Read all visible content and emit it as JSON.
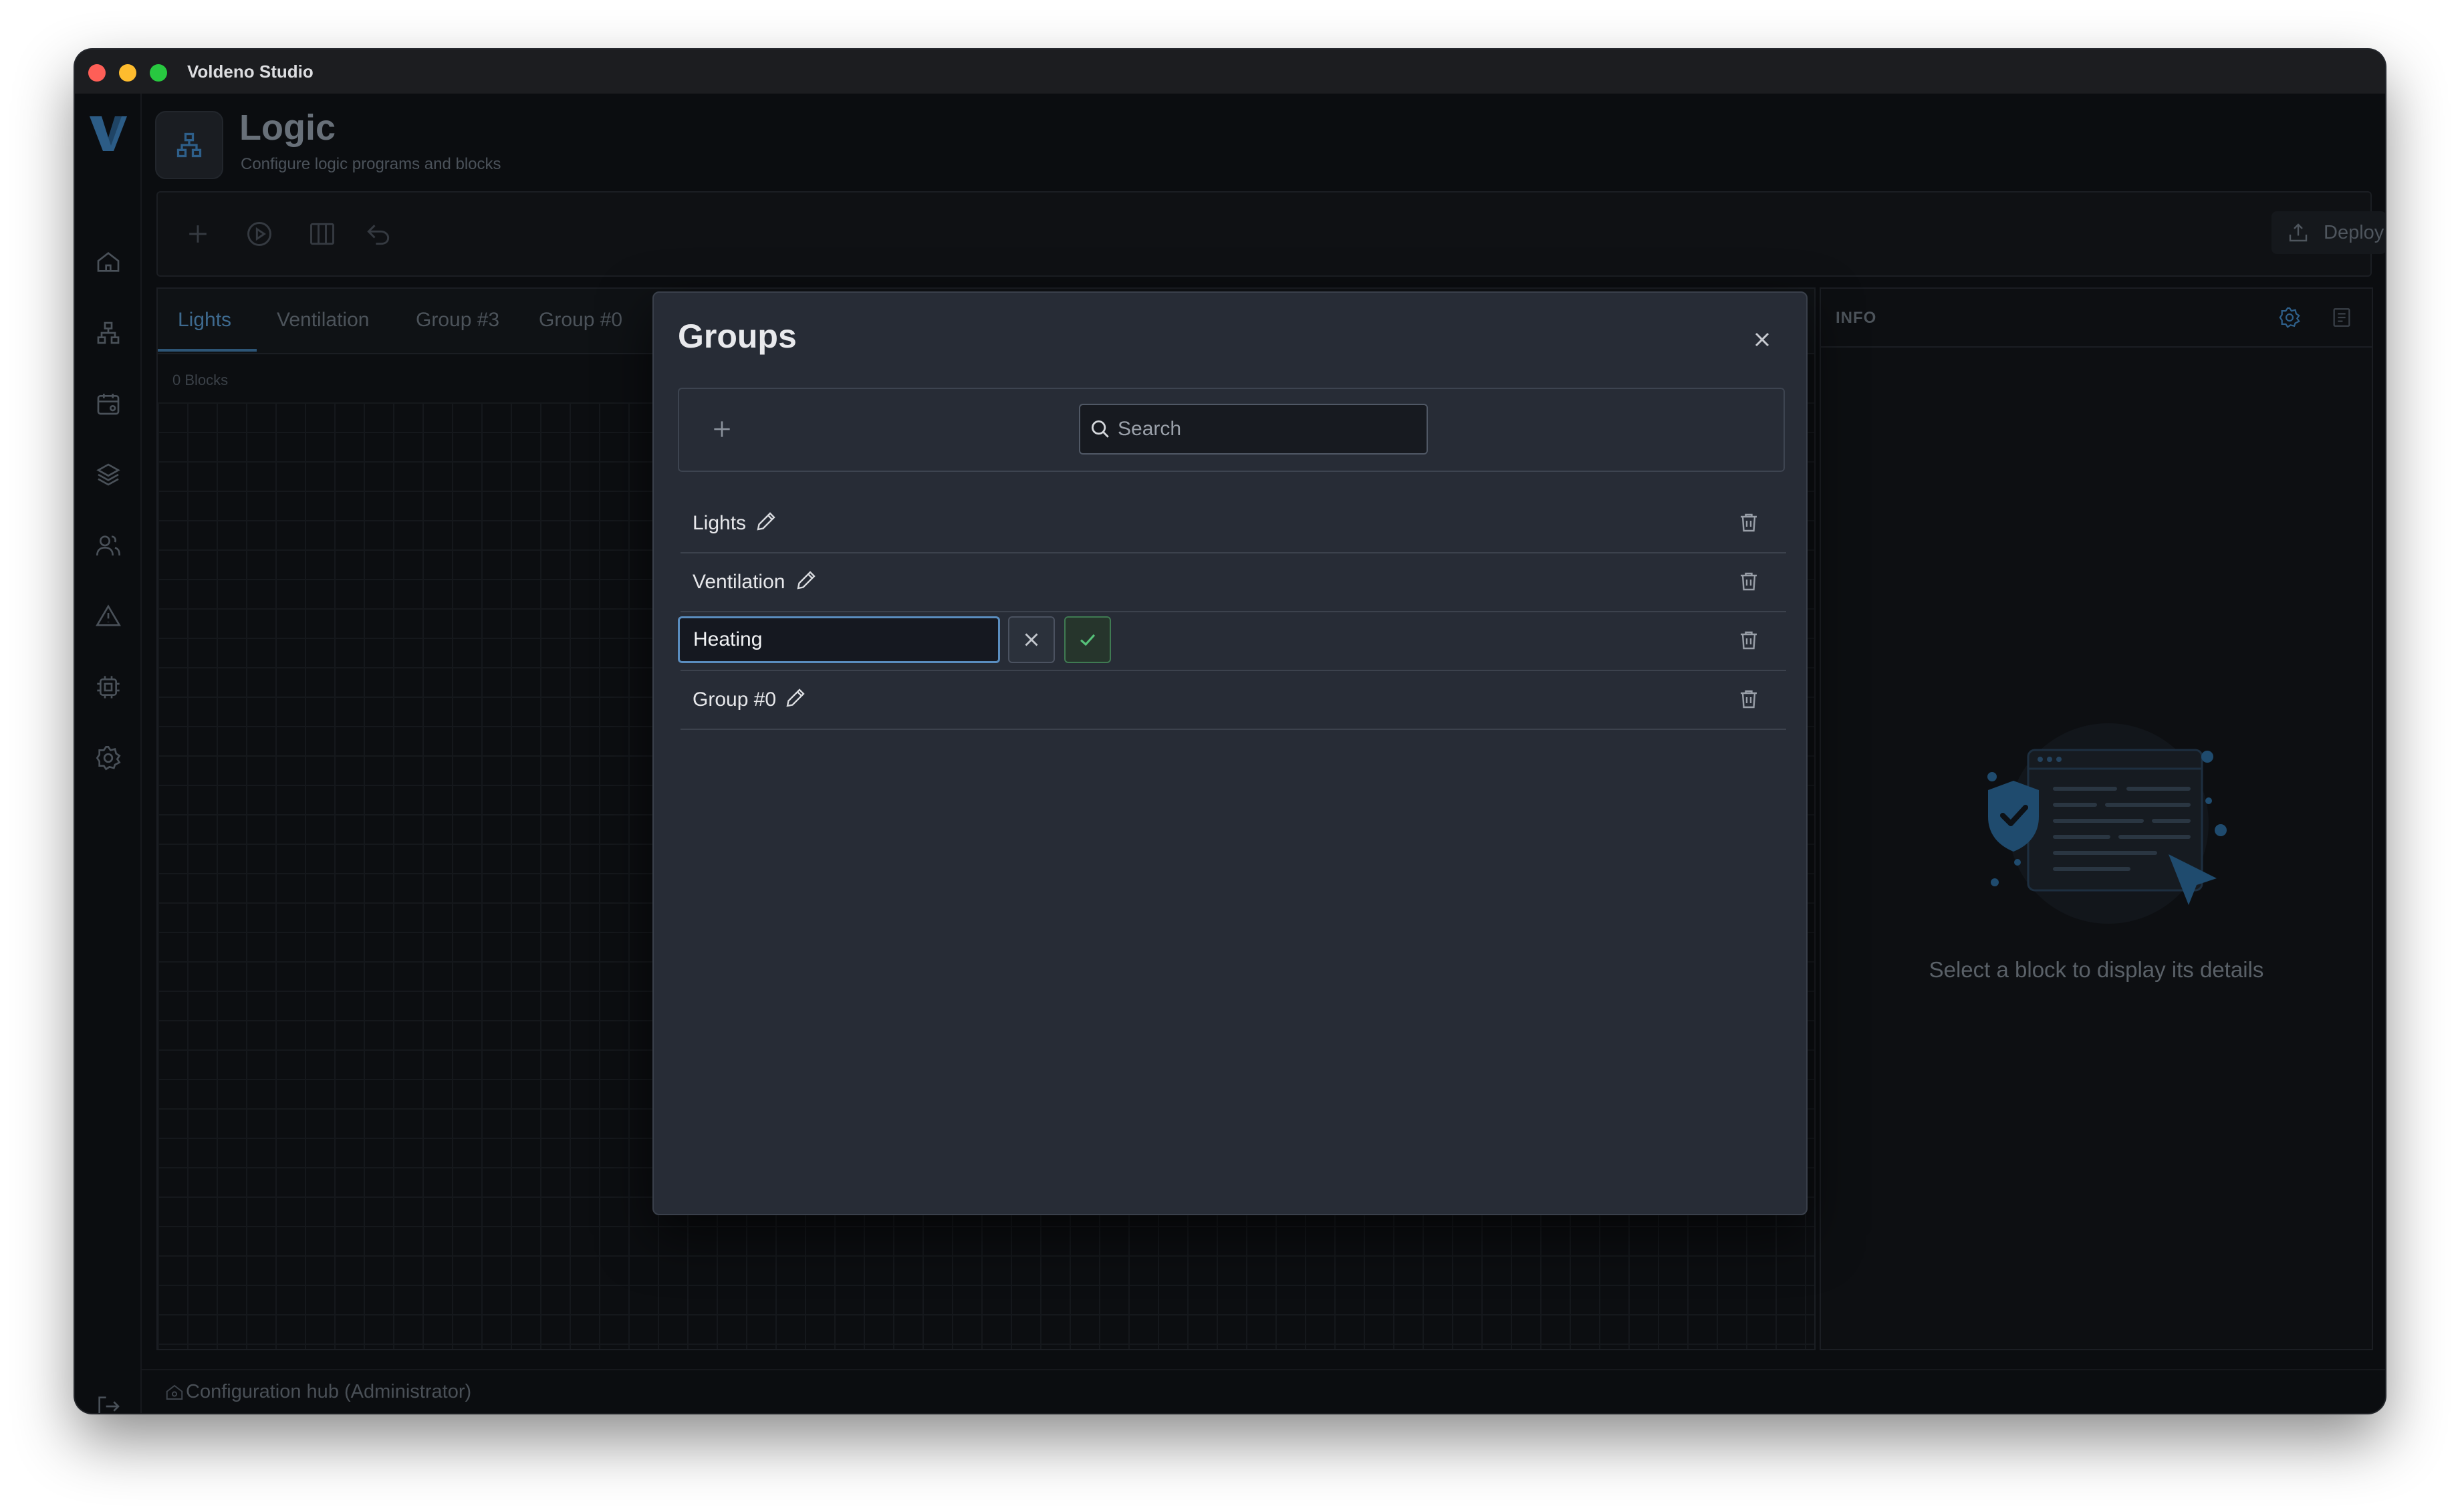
{
  "window": {
    "title": "Voldeno Studio"
  },
  "page": {
    "title": "Logic",
    "subtitle": "Configure logic programs and blocks"
  },
  "sidebar": {
    "items": [
      "logo-icon",
      "home-icon",
      "logic-icon",
      "calendar-icon",
      "layers-icon",
      "users-icon",
      "warning-icon",
      "chip-icon",
      "gear-icon",
      "logout-icon"
    ]
  },
  "toolbar": {
    "icons": [
      "plus-icon",
      "play-icon",
      "columns-icon",
      "undo-icon"
    ],
    "deploy_label": "Deploy"
  },
  "tabs": [
    {
      "label": "Lights",
      "active": true
    },
    {
      "label": "Ventilation",
      "active": false
    },
    {
      "label": "Group #3",
      "active": false
    },
    {
      "label": "Group #0",
      "active": false
    }
  ],
  "canvas": {
    "block_count": "0 Blocks"
  },
  "info": {
    "title": "INFO",
    "empty_message": "Select a block to display its details"
  },
  "status": {
    "text": "Configuration hub (Administrator)"
  },
  "modal": {
    "title": "Groups",
    "search": {
      "placeholder": "Search",
      "value": ""
    },
    "groups": [
      {
        "name": "Lights",
        "editing": false
      },
      {
        "name": "Ventilation",
        "editing": false
      },
      {
        "name": "Heating",
        "editing": true
      },
      {
        "name": "Group #0",
        "editing": false
      }
    ]
  },
  "colors": {
    "accent": "#3e6a8f",
    "modal_bg": "#272c36",
    "confirm": "#4caf70",
    "window_bg": "#0b0d10"
  }
}
